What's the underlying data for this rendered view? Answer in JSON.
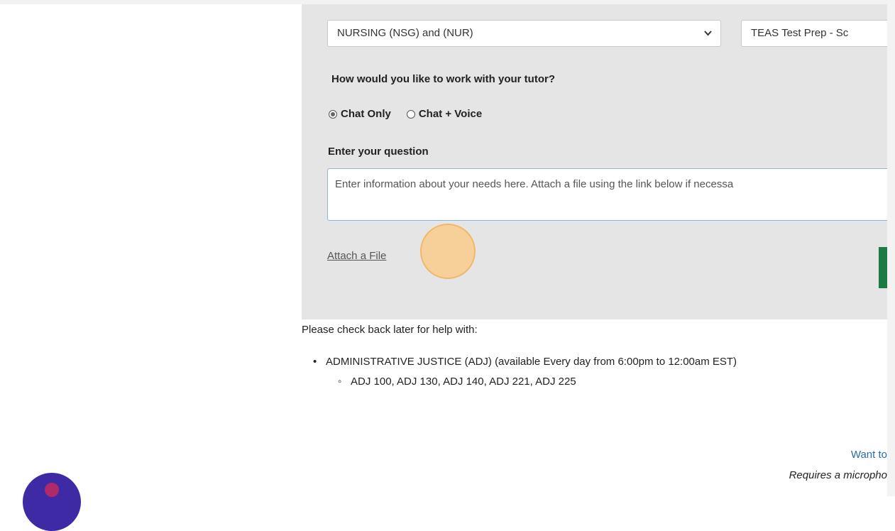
{
  "form": {
    "subject_select": {
      "value": "NURSING (NSG) and (NUR)"
    },
    "course_select": {
      "value": "TEAS Test Prep - Sc"
    },
    "work_question": "How would you like to work with your tutor?",
    "options": [
      {
        "label": "Chat Only",
        "checked": true
      },
      {
        "label": "Chat + Voice",
        "checked": false
      }
    ],
    "question_label": "Enter your question",
    "question_placeholder": "Enter information about your needs here.  Attach a file using the link below if necessa",
    "attach_link": "Attach a File"
  },
  "availability": {
    "intro": "Please check back later for help with:",
    "subject": "ADMINISTRATIVE JUSTICE (ADJ) (available Every day from 6:00pm to 12:00am EST)",
    "courses": "ADJ 100, ADJ 130, ADJ 140, ADJ 221, ADJ 225"
  },
  "footer": {
    "voice_link": "Want to",
    "requires": "Requires a micropho"
  },
  "colors": {
    "panel_bg": "#e5e5e5",
    "submit_green": "#1e7a44",
    "link_blue": "#2a6bb0",
    "chat_bubble": "#3f2aa5"
  },
  "icons": {
    "select_chevron": "chevron-down-icon",
    "chat_launcher": "chat-icon"
  }
}
